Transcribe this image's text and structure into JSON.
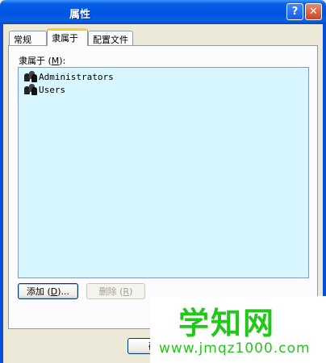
{
  "window": {
    "title": "属性",
    "help_label": "?",
    "close_label": "✕"
  },
  "tabs": [
    {
      "label": "常规"
    },
    {
      "label": "隶属于"
    },
    {
      "label": "配置文件"
    }
  ],
  "member_of": {
    "label_prefix": "隶属于 (",
    "label_key": "M",
    "label_suffix": "):",
    "items": [
      {
        "name": "Administrators",
        "icon": "user-group-icon"
      },
      {
        "name": "Users",
        "icon": "user-group-icon"
      }
    ]
  },
  "buttons": {
    "add_prefix": "添加 (",
    "add_key": "D",
    "add_suffix": ")...",
    "remove_prefix": "删除 (",
    "remove_key": "R",
    "remove_suffix": ")",
    "ok_fragment": "确"
  },
  "watermark": {
    "main": "学知网",
    "sub": "www.jmqz1000.com"
  }
}
